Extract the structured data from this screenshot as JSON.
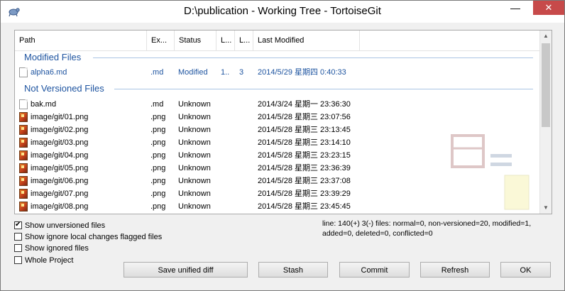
{
  "window": {
    "title": "D:\\publication - Working Tree - TortoiseGit",
    "minimize_glyph": "—",
    "close_glyph": "✕",
    "app_icon": "tortoisegit-icon"
  },
  "columns": [
    "Path",
    "Ex...",
    "Status",
    "L...",
    "L...",
    "Last Modified"
  ],
  "groups": {
    "modified": "Modified Files",
    "not_versioned": "Not Versioned Files"
  },
  "modified_files": [
    {
      "path": "alpha6.md",
      "ext": ".md",
      "status": "Modified",
      "l1": "1..",
      "l2": "3",
      "modified": "2014/5/29 星期四 0:40:33",
      "icon": "document-icon"
    }
  ],
  "unversioned_files": [
    {
      "path": "bak.md",
      "ext": ".md",
      "status": "Unknown",
      "modified": "2014/3/24 星期一 23:36:30",
      "icon": "document-icon"
    },
    {
      "path": "image/git/01.png",
      "ext": ".png",
      "status": "Unknown",
      "modified": "2014/5/28 星期三 23:07:56",
      "icon": "image-file-icon"
    },
    {
      "path": "image/git/02.png",
      "ext": ".png",
      "status": "Unknown",
      "modified": "2014/5/28 星期三 23:13:45",
      "icon": "image-file-icon"
    },
    {
      "path": "image/git/03.png",
      "ext": ".png",
      "status": "Unknown",
      "modified": "2014/5/28 星期三 23:14:10",
      "icon": "image-file-icon"
    },
    {
      "path": "image/git/04.png",
      "ext": ".png",
      "status": "Unknown",
      "modified": "2014/5/28 星期三 23:23:15",
      "icon": "image-file-icon"
    },
    {
      "path": "image/git/05.png",
      "ext": ".png",
      "status": "Unknown",
      "modified": "2014/5/28 星期三 23:36:39",
      "icon": "image-file-icon"
    },
    {
      "path": "image/git/06.png",
      "ext": ".png",
      "status": "Unknown",
      "modified": "2014/5/28 星期三 23:37:08",
      "icon": "image-file-icon"
    },
    {
      "path": "image/git/07.png",
      "ext": ".png",
      "status": "Unknown",
      "modified": "2014/5/28 星期三 23:39:29",
      "icon": "image-file-icon"
    },
    {
      "path": "image/git/08.png",
      "ext": ".png",
      "status": "Unknown",
      "modified": "2014/5/28 星期三 23:45:45",
      "icon": "image-file-icon"
    }
  ],
  "options": {
    "show_unversioned": {
      "label": "Show unversioned files",
      "checked": true
    },
    "show_ignore_local": {
      "label": "Show ignore local changes flagged files",
      "checked": false
    },
    "show_ignored": {
      "label": "Show ignored files",
      "checked": false
    },
    "whole_project": {
      "label": "Whole Project",
      "checked": false
    }
  },
  "summary": "line: 140(+) 3(-) files: normal=0, non-versioned=20, modified=1, added=0, deleted=0, conflicted=0",
  "buttons": {
    "save_diff": "Save unified diff",
    "stash": "Stash",
    "commit": "Commit",
    "refresh": "Refresh",
    "ok": "OK"
  },
  "colors": {
    "group_header": "#1e54a0",
    "modified_text": "#1e54a0",
    "close_button": "#c74a4a"
  }
}
